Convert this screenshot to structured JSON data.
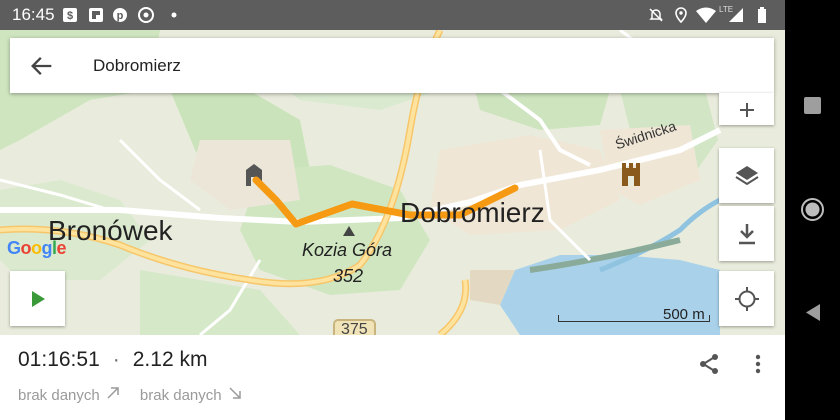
{
  "status_bar": {
    "time": "16:45",
    "left_icons": [
      "stash-s-icon",
      "flipboard-icon",
      "pinterest-icon",
      "chrome-icon",
      "dot-icon"
    ],
    "right_icons": [
      "dnd-off-icon",
      "location-icon",
      "wifi-icon",
      "signal-icon",
      "battery-icon"
    ],
    "network_label": "LTE"
  },
  "title_bar": {
    "title": "Dobromierz",
    "back_icon": "arrow-left-icon"
  },
  "map": {
    "labels": {
      "bronowek": "Bronówek",
      "dobromierz": "Dobromierz",
      "kozia_gora": "Kozia Góra",
      "elevation": "352",
      "road": "375",
      "street": "Świdnicka"
    },
    "attribution": "Google",
    "scale": "500 m",
    "route_color": "#f59a12",
    "controls": [
      "plus-icon",
      "layers-icon",
      "download-icon",
      "my-location-icon",
      "play-icon"
    ]
  },
  "track": {
    "duration": "01:16:51",
    "separator": "·",
    "distance": "2.12 km",
    "ascent": "brak danych",
    "descent": "brak danych"
  },
  "actions": [
    "share-icon",
    "more-vert-icon"
  ],
  "nav_bar": [
    "square-icon",
    "circle-icon",
    "triangle-back-icon"
  ]
}
